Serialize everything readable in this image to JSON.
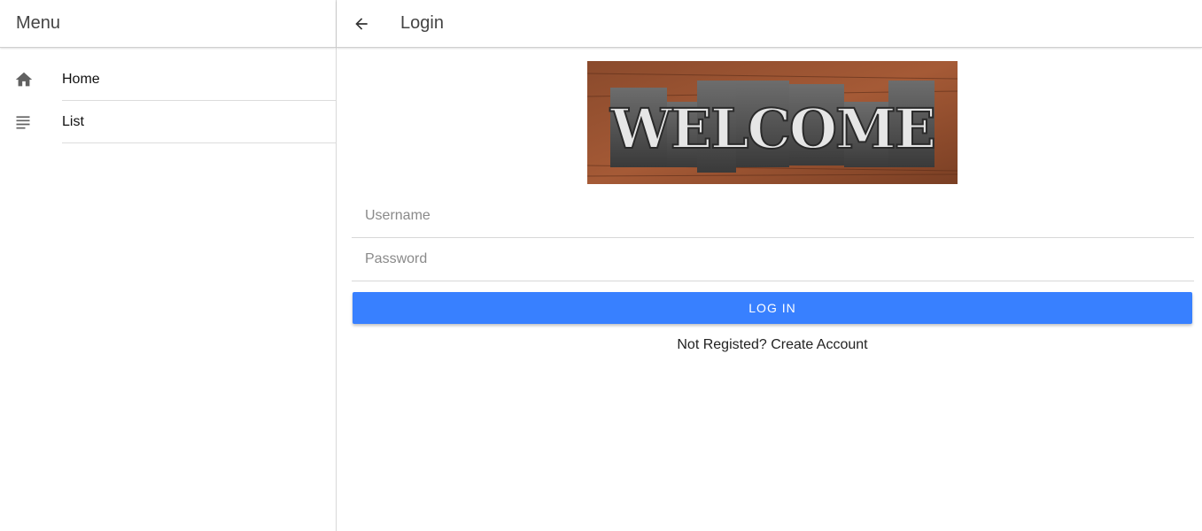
{
  "sidebar": {
    "title": "Menu",
    "items": [
      {
        "label": "Home",
        "icon": "home-icon"
      },
      {
        "label": "List",
        "icon": "list-icon"
      }
    ]
  },
  "header": {
    "title": "Login",
    "back_icon": "arrow-back-icon"
  },
  "banner": {
    "text": "WELCOME"
  },
  "form": {
    "username_placeholder": "Username",
    "username_value": "",
    "password_placeholder": "Password",
    "password_value": "",
    "login_label": "LOG IN",
    "register_text": "Not Registed? Create Account"
  },
  "colors": {
    "primary": "#3880ff",
    "text": "#222222",
    "icon": "#616161",
    "divider": "#d9d9d9"
  }
}
